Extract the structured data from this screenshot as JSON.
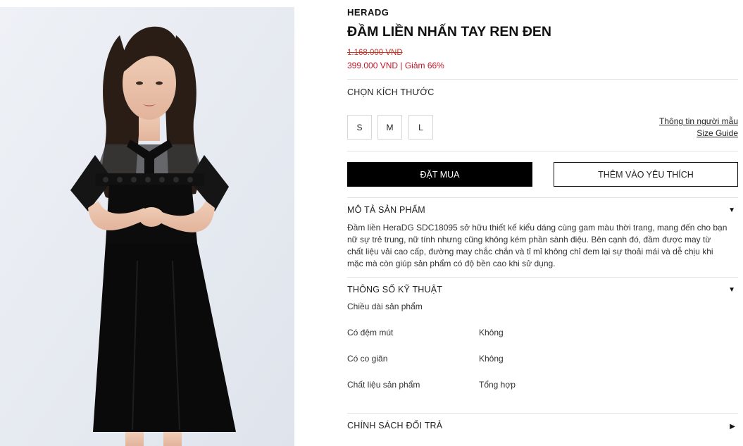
{
  "product": {
    "brand": "HERADG",
    "title": "ĐẦM LIỀN NHẤN TAY REN ĐEN",
    "old_price": "1.168.000 VND",
    "new_price": "399.000 VND | Giảm 66%"
  },
  "sizes": {
    "label": "CHỌN KÍCH THƯỚC",
    "options": [
      "S",
      "M",
      "L"
    ],
    "model_info_link": "Thông tin người mẫu",
    "size_guide_link": "Size Guide"
  },
  "actions": {
    "buy_label": "ĐẶT MUA",
    "favorite_label": "THÊM VÀO YÊU THÍCH"
  },
  "description": {
    "title": "MÔ TẢ SẢN PHẨM",
    "text": "Đầm liền HeraDG SDC18095 sở hữu thiết kế kiểu dáng cùng gam màu thời trang, mang đến cho bạn nữ sự trẻ trung, nữ tính nhưng cũng không kém phần sành điệu. Bên cạnh đó, đầm được may từ chất liệu vải cao cấp, đường may chắc chắn và tỉ mỉ không chỉ đem lại sự thoải mái và dễ chịu khi mặc mà còn giúp sản phẩm có độ bền cao khi sử dụng."
  },
  "specs": {
    "title": "THÔNG SỐ KỸ THUẬT",
    "subtitle": "Chiều dài sản phẩm",
    "rows": [
      {
        "key": "Có đệm mút",
        "value": "Không"
      },
      {
        "key": "Có co giãn",
        "value": "Không"
      },
      {
        "key": "Chất liệu sản phẩm",
        "value": "Tổng hợp"
      }
    ]
  },
  "policy": {
    "title": "CHÍNH SÁCH ĐỔI TRẢ"
  },
  "icons": {
    "expanded": "caret-down-icon",
    "collapsed": "caret-right-icon"
  }
}
